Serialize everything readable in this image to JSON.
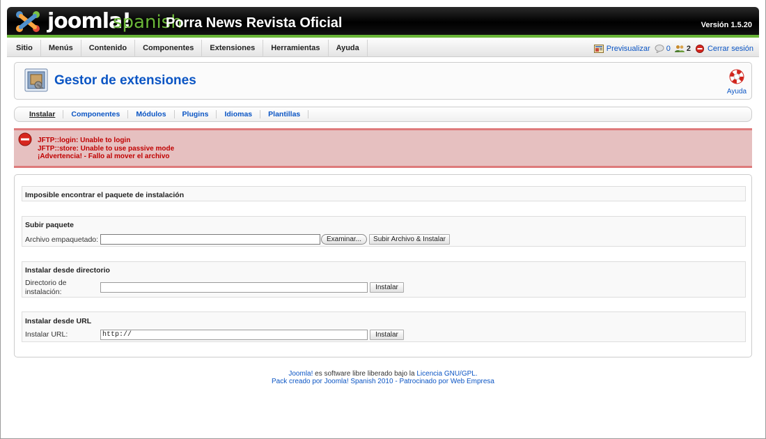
{
  "header": {
    "logo_text": "joomla!",
    "logo_sub": "spanish",
    "site_title": "Porra News Revista Oficial",
    "version": "Versión 1.5.20"
  },
  "menu": {
    "items": [
      {
        "label": "Sitio"
      },
      {
        "label": "Menús"
      },
      {
        "label": "Contenido"
      },
      {
        "label": "Componentes"
      },
      {
        "label": "Extensiones"
      },
      {
        "label": "Herramientas"
      },
      {
        "label": "Ayuda"
      }
    ]
  },
  "status": {
    "preview_label": "Previsualizar",
    "messages_count": "0",
    "users_count": "2",
    "logout_label": "Cerrar sesión"
  },
  "toolbar": {
    "title": "Gestor de extensiones",
    "help_label": "Ayuda"
  },
  "submenu": {
    "items": [
      {
        "label": "Instalar",
        "active": true
      },
      {
        "label": "Componentes"
      },
      {
        "label": "Módulos"
      },
      {
        "label": "Plugins"
      },
      {
        "label": "Idiomas"
      },
      {
        "label": "Plantillas"
      }
    ]
  },
  "errors": [
    "JFTP::login: Unable to login",
    "JFTP::store: Unable to use passive mode",
    "¡Advertencia! - Fallo al mover el archivo"
  ],
  "main": {
    "notice": "Imposible encontrar el paquete de instalación",
    "upload": {
      "title": "Subir paquete",
      "label": "Archivo empaquetado:",
      "browse_label": "Examinar...",
      "submit_label": "Subir Archivo & Instalar"
    },
    "directory": {
      "title": "Instalar desde directorio",
      "label_line1": "Directorio de",
      "label_line2": "instalación:",
      "value": "",
      "submit_label": "Instalar"
    },
    "url": {
      "title": "Instalar desde URL",
      "label": "Instalar URL:",
      "value": "http://",
      "submit_label": "Instalar"
    }
  },
  "footer": {
    "line1_link": "Joomla!",
    "line1_text": " es software libre liberado bajo la ",
    "line1_license": "Licencia GNU/GPL.",
    "line2": "Pack creado por Joomla! Spanish 2010 - Patrocinado por Web Empresa"
  },
  "colors": {
    "brand_green": "#6ab638",
    "link_blue": "#0b55c4",
    "error_red": "#c00000",
    "error_bg": "#e6c0c0"
  }
}
